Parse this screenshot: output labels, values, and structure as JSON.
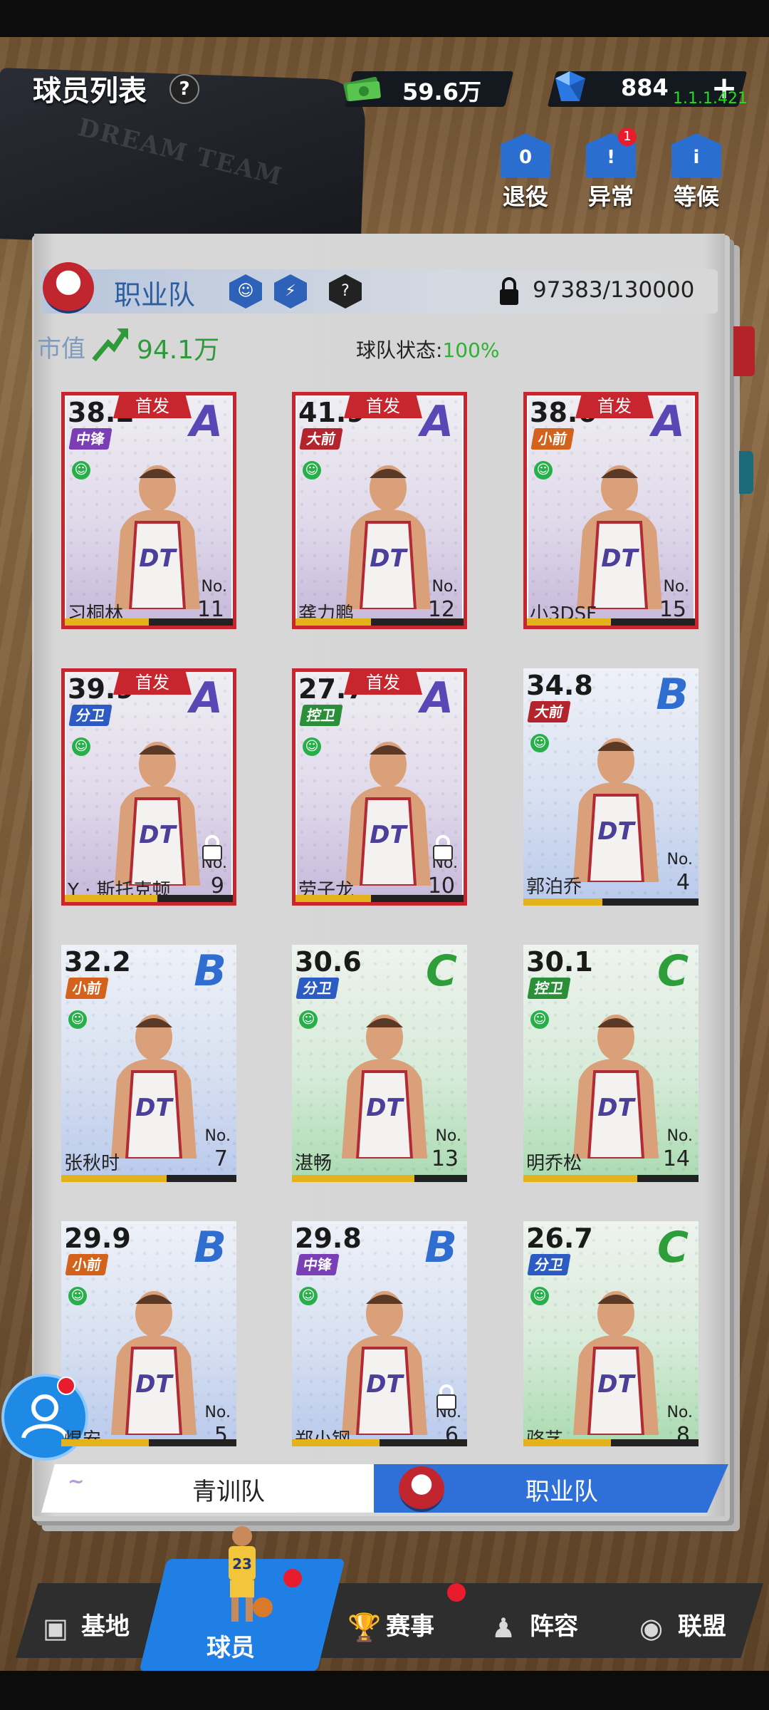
{
  "header": {
    "title": "球员列表",
    "help_glyph": "?",
    "money": "59.6万",
    "gems": "884",
    "version": "1.1.1.421",
    "plus_glyph": "+"
  },
  "dark_book_text": "DREAM TEAM",
  "actions": [
    {
      "label": "退役",
      "icon": "retire-icon",
      "badge": ""
    },
    {
      "label": "异常",
      "icon": "warning-icon",
      "badge": "1"
    },
    {
      "label": "等候",
      "icon": "waiting-icon",
      "badge": ""
    }
  ],
  "team": {
    "name": "职业队",
    "capacity": "97383/130000",
    "market_value_label": "市值",
    "market_value": "94.1万",
    "status_label": "球队状态:",
    "status_value": "100%"
  },
  "cards": [
    {
      "rating": "38.2",
      "grade": "A",
      "position": "中锋",
      "pos_color": "purple",
      "name": "习桐林",
      "no_label": "No.",
      "number": "11",
      "starter": true,
      "starter_label": "首发",
      "xp": 0.5,
      "locked": false
    },
    {
      "rating": "41.9",
      "grade": "A",
      "position": "大前",
      "pos_color": "red",
      "name": "龚力鹏",
      "no_label": "No.",
      "number": "12",
      "starter": true,
      "starter_label": "首发",
      "xp": 0.45,
      "locked": false
    },
    {
      "rating": "38.6",
      "grade": "A",
      "position": "小前",
      "pos_color": "orange",
      "name": "小3DSF",
      "no_label": "No.",
      "number": "15",
      "starter": true,
      "starter_label": "首发",
      "xp": 0.5,
      "locked": false
    },
    {
      "rating": "39.9",
      "grade": "A",
      "position": "分卫",
      "pos_color": "blue",
      "name": "Y · 斯托克顿",
      "no_label": "No.",
      "number": "9",
      "starter": true,
      "starter_label": "首发",
      "xp": 0.55,
      "locked": true
    },
    {
      "rating": "27.7",
      "grade": "A",
      "position": "控卫",
      "pos_color": "green",
      "name": "劳子龙",
      "no_label": "No.",
      "number": "10",
      "starter": true,
      "starter_label": "首发",
      "xp": 0.45,
      "locked": true
    },
    {
      "rating": "34.8",
      "grade": "B",
      "position": "大前",
      "pos_color": "red",
      "name": "郭泊乔",
      "no_label": "No.",
      "number": "4",
      "starter": false,
      "starter_label": "",
      "xp": 0.45,
      "locked": false
    },
    {
      "rating": "32.2",
      "grade": "B",
      "position": "小前",
      "pos_color": "orange",
      "name": "张秋时",
      "no_label": "No.",
      "number": "7",
      "starter": false,
      "starter_label": "",
      "xp": 0.6,
      "locked": false
    },
    {
      "rating": "30.6",
      "grade": "C",
      "position": "分卫",
      "pos_color": "blue",
      "name": "湛畅",
      "no_label": "No.",
      "number": "13",
      "starter": false,
      "starter_label": "",
      "xp": 0.7,
      "locked": false
    },
    {
      "rating": "30.1",
      "grade": "C",
      "position": "控卫",
      "pos_color": "green",
      "name": "明乔松",
      "no_label": "No.",
      "number": "14",
      "starter": false,
      "starter_label": "",
      "xp": 0.65,
      "locked": false
    },
    {
      "rating": "29.9",
      "grade": "B",
      "position": "小前",
      "pos_color": "orange",
      "name": "焜安",
      "no_label": "No.",
      "number": "5",
      "starter": false,
      "starter_label": "",
      "xp": 0.5,
      "locked": false
    },
    {
      "rating": "29.8",
      "grade": "B",
      "position": "中锋",
      "pos_color": "purple",
      "name": "郑小钢",
      "no_label": "No.",
      "number": "6",
      "starter": false,
      "starter_label": "",
      "xp": 0.5,
      "locked": true
    },
    {
      "rating": "26.7",
      "grade": "C",
      "position": "分卫",
      "pos_color": "blue",
      "name": "骆艺",
      "no_label": "No.",
      "number": "8",
      "starter": false,
      "starter_label": "",
      "xp": 0.5,
      "locked": false
    }
  ],
  "switcher": {
    "youth": "青训队",
    "pro": "职业队",
    "selected": "职业队"
  },
  "nav": [
    {
      "label": "基地",
      "icon": "stadium-icon",
      "active": false,
      "dot": false
    },
    {
      "label": "球员",
      "icon": "player-icon",
      "active": true,
      "dot": true
    },
    {
      "label": "赛事",
      "icon": "trophy-icon",
      "active": false,
      "dot": true
    },
    {
      "label": "阵容",
      "icon": "lineup-icon",
      "active": false,
      "dot": false
    },
    {
      "label": "联盟",
      "icon": "league-icon",
      "active": false,
      "dot": false
    }
  ],
  "colors": {
    "accent": "#2e6fd8",
    "starter_border": "#c8262f",
    "status_green": "#2bb331",
    "market_green": "#2f9a3a"
  }
}
